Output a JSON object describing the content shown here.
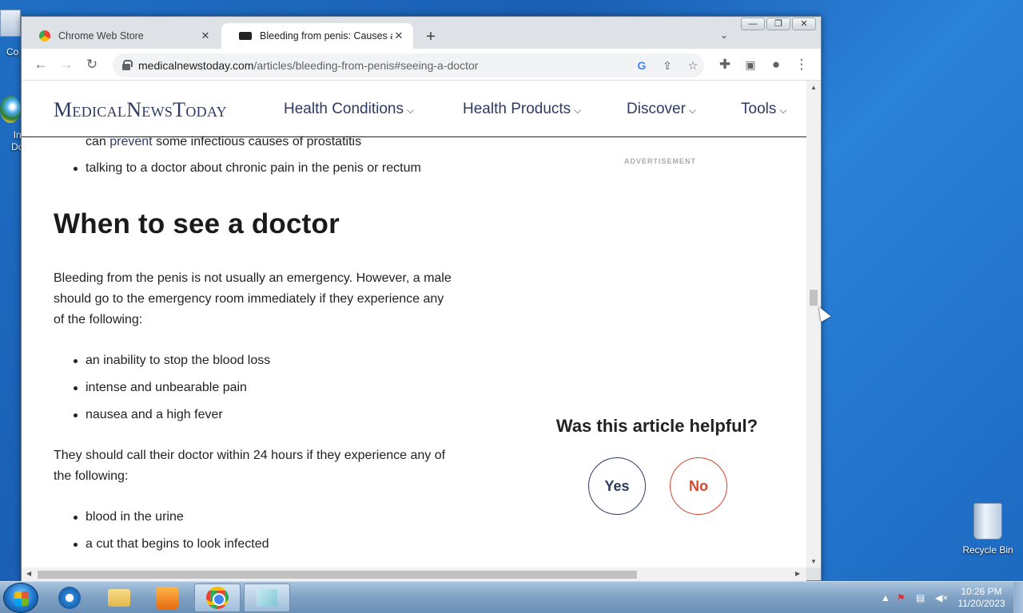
{
  "desktop": {
    "left_icon_1_label": "Co",
    "left_icon_2_label": "In\nDo",
    "recycle_bin_label": "Recycle Bin"
  },
  "browser": {
    "tabs": [
      {
        "title": "Chrome Web Store",
        "active": false
      },
      {
        "title": "Bleeding from penis: Causes and",
        "active": true
      }
    ],
    "window_controls": {
      "minimize": "—",
      "restore": "❐",
      "close": "✕"
    },
    "url_host": "medicalnewstoday.com",
    "url_path": "/articles/bleeding-from-penis#seeing-a-doctor"
  },
  "site": {
    "logo": "MedicalNewsToday",
    "nav": [
      "Health Conditions",
      "Health Products",
      "Discover",
      "Tools"
    ]
  },
  "article": {
    "top_line_prefix": "can ",
    "top_line_link": "prevent",
    "top_line_suffix": " some infectious causes of prostatitis",
    "bullet_top": "talking to a doctor about chronic pain in the penis or rectum",
    "heading": "When to see a doctor",
    "para1": [
      "Bleeding from the penis is not usually an emergency. However, a male",
      "should go to the emergency room immediately if they experience any",
      "of the following:"
    ],
    "emergency_list": [
      "an inability to stop the blood loss",
      "intense and unbearable pain",
      "nausea and a high fever"
    ],
    "para2": [
      "They should call their doctor within 24 hours if they experience any of",
      "the following:"
    ],
    "call_list": [
      "blood in the urine",
      "a cut that begins to look infected"
    ]
  },
  "sidebar": {
    "advertisement": "ADVERTISEMENT",
    "helpful_question": "Was this article helpful?",
    "yes": "Yes",
    "no": "No"
  },
  "taskbar": {
    "time": "10:26 PM",
    "date": "11/20/2023"
  }
}
